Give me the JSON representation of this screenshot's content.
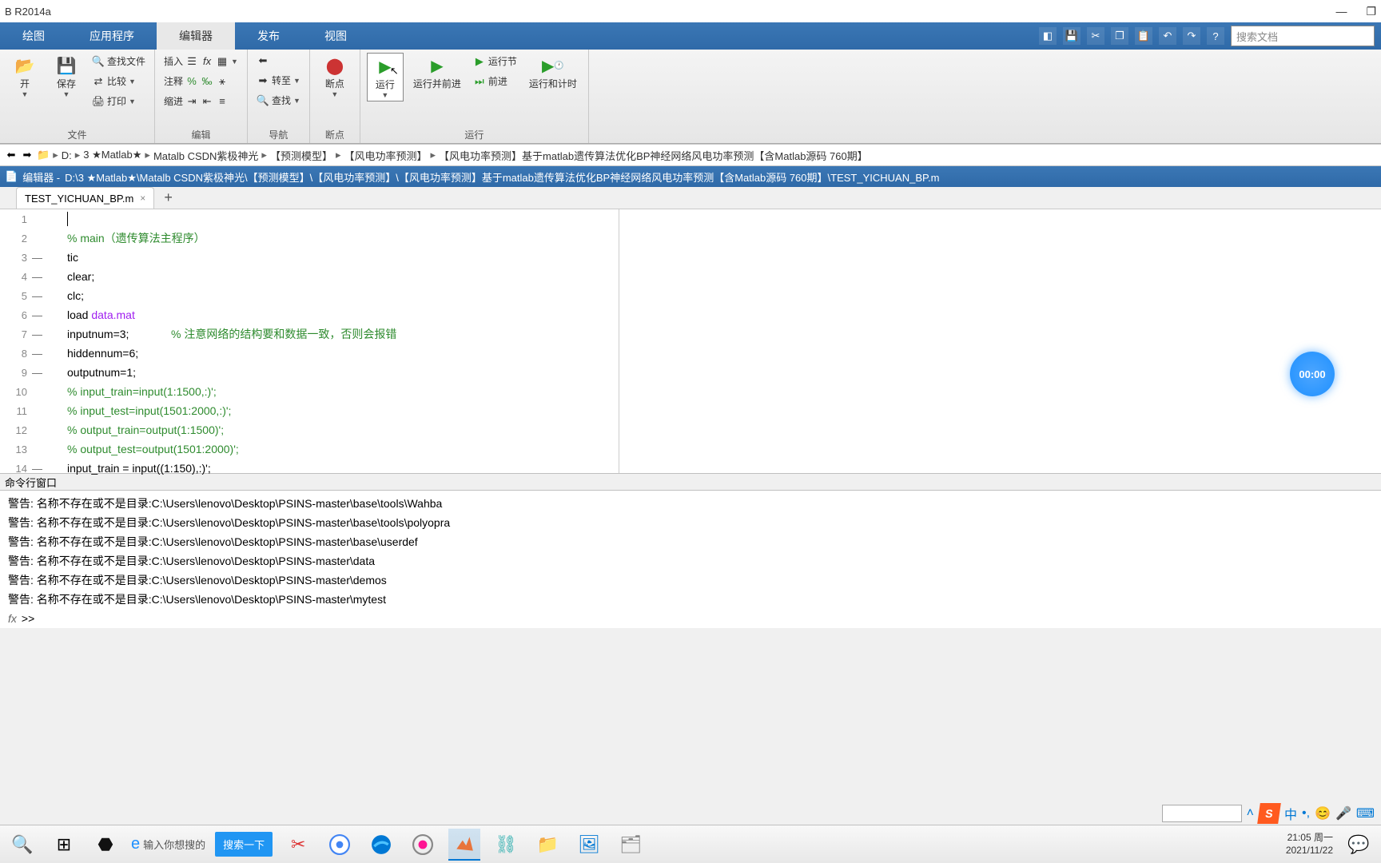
{
  "window": {
    "title": "B R2014a"
  },
  "tabs": {
    "plot": "绘图",
    "app": "应用程序",
    "editor": "编辑器",
    "publish": "发布",
    "view": "视图"
  },
  "search": {
    "placeholder": "搜索文档"
  },
  "ribbon": {
    "file": {
      "open": "开",
      "save": "保存",
      "find_files": "查找文件",
      "compare": "比较",
      "print": "打印",
      "group": "文件"
    },
    "edit": {
      "insert": "插入",
      "comment": "注释",
      "indent": "缩进",
      "fx": "fx",
      "group": "编辑"
    },
    "nav": {
      "goto": "转至",
      "find": "查找",
      "group": "导航"
    },
    "break": {
      "breakpoints": "断点",
      "group": "断点"
    },
    "run": {
      "run": "运行",
      "run_advance": "运行并前进",
      "run_section": "运行节",
      "advance": "前进",
      "run_time": "运行和计时",
      "group": "运行"
    }
  },
  "address": {
    "drive": "D:",
    "crumbs": [
      "3 ★Matlab★",
      "Matalb CSDN紫极神光",
      "【预测模型】",
      "【风电功率预测】",
      "【风电功率预测】基于matlab遗传算法优化BP神经网络风电功率预测【含Matlab源码 760期】"
    ]
  },
  "editor": {
    "title_prefix": "编辑器 - ",
    "path": "D:\\3 ★Matlab★\\Matalb CSDN紫极神光\\【预测模型】\\【风电功率预测】\\【风电功率预测】基于matlab遗传算法优化BP神经网络风电功率预测【含Matlab源码 760期】\\TEST_YICHUAN_BP.m",
    "active_file": "TEST_YICHUAN_BP.m"
  },
  "code": {
    "l1": "",
    "l2_comment": "% main（遗传算法主程序）",
    "l3": "tic",
    "l4": "clear;",
    "l5": "clc;",
    "l6a": "load ",
    "l6b": "data.mat",
    "l7a": "inputnum=3;",
    "l7b": "% 注意网络的结构要和数据一致，否则会报错",
    "l8": "hiddennum=6;",
    "l9": "outputnum=1;",
    "l10": "% input_train=input(1:1500,:)';",
    "l11": "% input_test=input(1501:2000,:)';",
    "l12": "% output_train=output(1:1500)';",
    "l13": "% output_test=output(1501:2000)';",
    "l14": "input_train = input((1:150),:)';"
  },
  "cmd": {
    "title": "命令行窗口",
    "prefix": "警告: 名称不存在或不是目录: ",
    "lines": [
      "C:\\Users\\lenovo\\Desktop\\PSINS-master\\base\\tools\\Wahba",
      "C:\\Users\\lenovo\\Desktop\\PSINS-master\\base\\tools\\polyopra",
      "C:\\Users\\lenovo\\Desktop\\PSINS-master\\base\\userdef",
      "C:\\Users\\lenovo\\Desktop\\PSINS-master\\data",
      "C:\\Users\\lenovo\\Desktop\\PSINS-master\\demos",
      "C:\\Users\\lenovo\\Desktop\\PSINS-master\\mytest"
    ],
    "prompt": ">>",
    "fx": "fx"
  },
  "timer": "00:00",
  "ime": {
    "label": "S",
    "zhong": "中"
  },
  "taskbar": {
    "search_hint": "输入你想搜的",
    "search_btn": "搜索一下",
    "time": "21:05 周一",
    "date": "2021/11/22"
  }
}
